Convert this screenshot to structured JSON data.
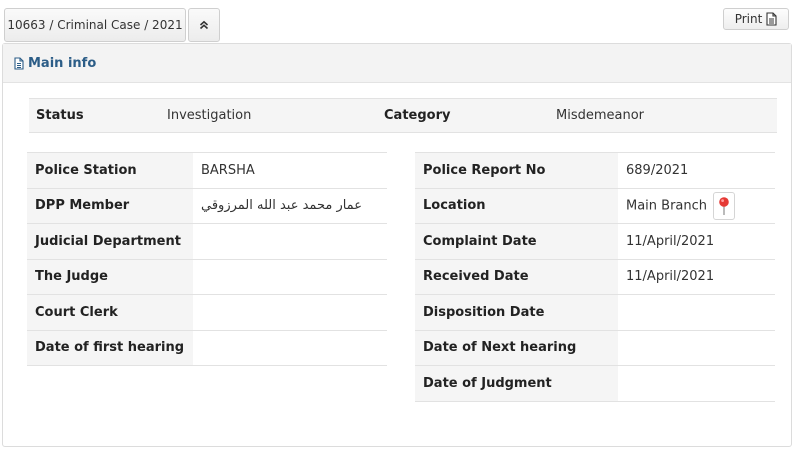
{
  "header": {
    "case_label": "10663 / Criminal Case / 2021",
    "print_label": "Print"
  },
  "panel": {
    "title": "Main info"
  },
  "status_row": {
    "status_label": "Status",
    "status_value": "Investigation",
    "category_label": "Category",
    "category_value": "Misdemeanor"
  },
  "left_table": [
    {
      "label": "Police Station",
      "value": "BARSHA"
    },
    {
      "label": "DPP Member",
      "value": "عمار محمد عبد الله المرزوقي"
    },
    {
      "label": "Judicial Department",
      "value": ""
    },
    {
      "label": "The Judge",
      "value": ""
    },
    {
      "label": "Court Clerk",
      "value": ""
    },
    {
      "label": "Date of first hearing",
      "value": ""
    }
  ],
  "right_table": [
    {
      "label": "Police Report No",
      "value": "689/2021"
    },
    {
      "label": "Location",
      "value": "Main Branch"
    },
    {
      "label": "Complaint Date",
      "value": "11/April/2021"
    },
    {
      "label": "Received Date",
      "value": "11/April/2021"
    },
    {
      "label": "Disposition Date",
      "value": ""
    },
    {
      "label": "Date of Next hearing",
      "value": ""
    },
    {
      "label": "Date of Judgment",
      "value": ""
    }
  ],
  "icons": {
    "collapse": "chevron-double-up-icon",
    "print": "document-icon",
    "title": "document-icon",
    "location": "map-pin-icon"
  },
  "colors": {
    "title": "#2c5d87",
    "pin": "#e53935"
  }
}
